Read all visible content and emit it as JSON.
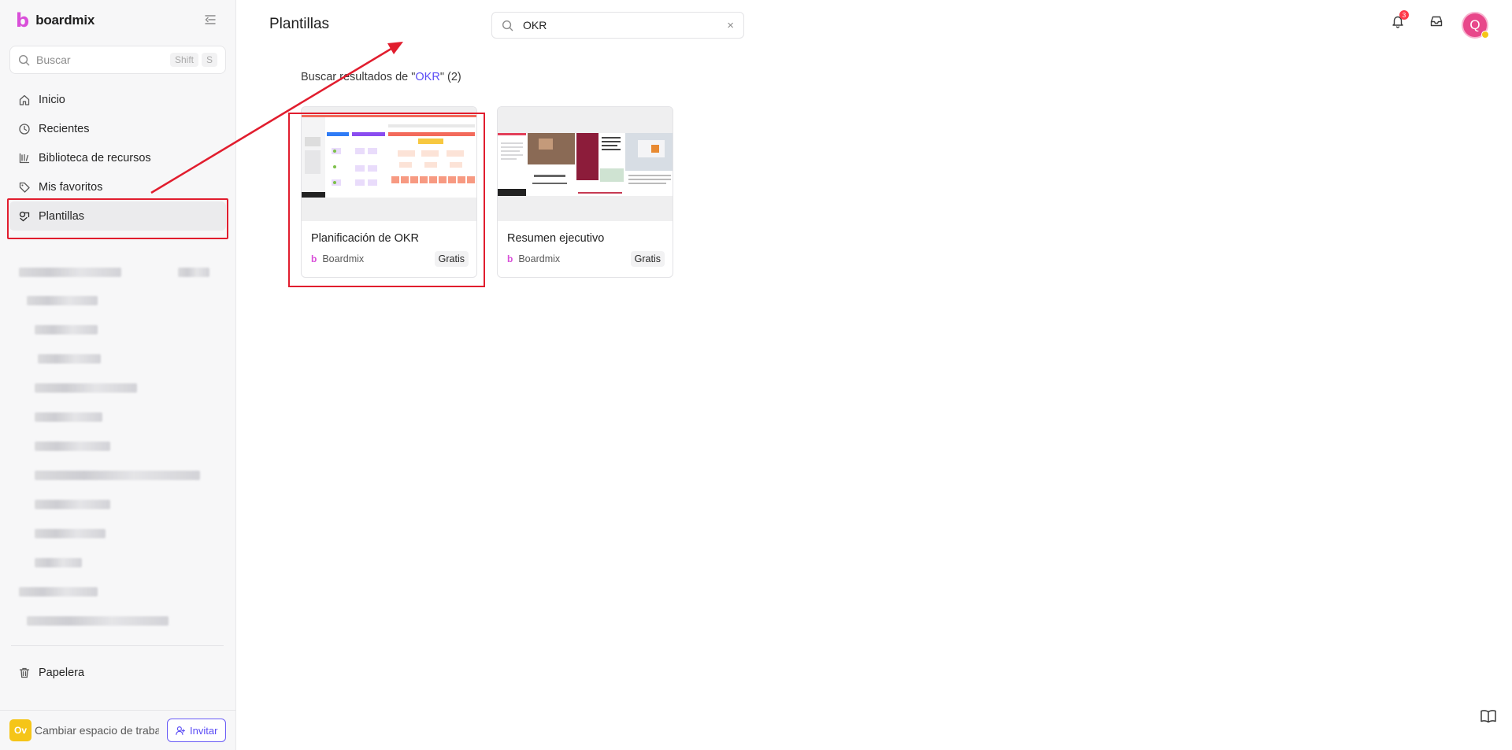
{
  "app": {
    "brand": "boardmix",
    "brand_icon": "b",
    "accent": "#5b4df5",
    "brand_color": "#d94fd9"
  },
  "sidebar": {
    "search": {
      "placeholder": "Buscar",
      "shortcut_1": "Shift",
      "shortcut_2": "S"
    },
    "items": [
      {
        "label": "Inicio",
        "icon": "home-icon"
      },
      {
        "label": "Recientes",
        "icon": "clock-icon"
      },
      {
        "label": "Biblioteca de recursos",
        "icon": "library-icon"
      },
      {
        "label": "Mis favoritos",
        "icon": "tag-icon"
      },
      {
        "label": "Plantillas",
        "icon": "templates-icon",
        "active": true
      }
    ],
    "trash_label": "Papelera",
    "workspace": {
      "initials": "Ov",
      "switch_label": "Cambiar espacio de trabajo"
    },
    "invite_label": "Invitar"
  },
  "header": {
    "title": "Plantillas",
    "search_value": "OKR",
    "notifications_count": "3",
    "user_initial": "Q"
  },
  "results": {
    "prefix": "Buscar resultados de \"",
    "keyword": "OKR",
    "suffix": "\" (2)",
    "cards": [
      {
        "title": "Planificación de OKR",
        "author": "Boardmix",
        "price": "Gratis"
      },
      {
        "title": "Resumen ejecutivo",
        "author": "Boardmix",
        "price": "Gratis"
      }
    ]
  }
}
